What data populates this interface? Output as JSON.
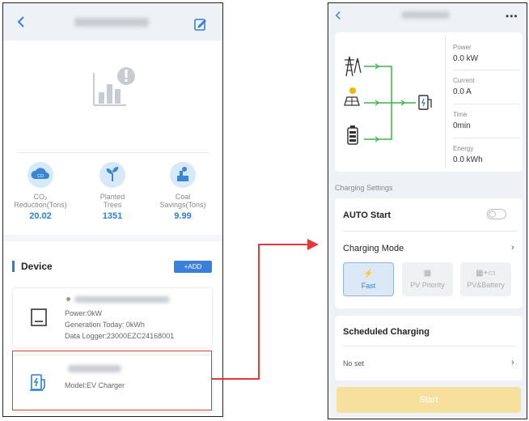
{
  "left": {
    "stats": [
      {
        "label_line1": "CO₂",
        "label_line2": "Reduction(Tons)",
        "value": "20.02",
        "icon": "co2-cloud-icon"
      },
      {
        "label_line1": "Planted",
        "label_line2": "Trees",
        "value": "1351",
        "icon": "tree-sprout-icon"
      },
      {
        "label_line1": "Coal",
        "label_line2": "Savings(Tons)",
        "value": "9.99",
        "icon": "power-plant-icon"
      }
    ],
    "device_section_title": "Device",
    "add_button_label": "+ADD",
    "inverter_card": {
      "power": "Power:0kW",
      "generation": "Generation Today: 0kWh",
      "logger": "Data Logger:23000EZC24168001"
    },
    "charger_card": {
      "model": "Model:EV Charger"
    }
  },
  "right": {
    "metrics": [
      {
        "label": "Power",
        "value": "0.0 kW"
      },
      {
        "label": "Current",
        "value": "0.0 A"
      },
      {
        "label": "Time",
        "value": "0min"
      },
      {
        "label": "Energy",
        "value": "0.0 kWh"
      }
    ],
    "charging_settings_label": "Charging Settings",
    "auto_start_label": "AUTO Start",
    "auto_start_on": false,
    "charging_mode_label": "Charging Mode",
    "modes": [
      {
        "label": "Fast",
        "icon": "fast-charge-icon",
        "selected": true
      },
      {
        "label": "PV Priority",
        "icon": "solar-panel-icon",
        "selected": false
      },
      {
        "label": "PV&Battery",
        "icon": "solar-battery-icon",
        "selected": false
      }
    ],
    "scheduled_label": "Scheduled Charging",
    "scheduled_value": "No set",
    "start_label": "Start"
  },
  "colors": {
    "accent": "#2e7fd4",
    "highlight": "#e03b3b",
    "flow_line": "#3bb34a",
    "start_button": "#f7df9e"
  }
}
